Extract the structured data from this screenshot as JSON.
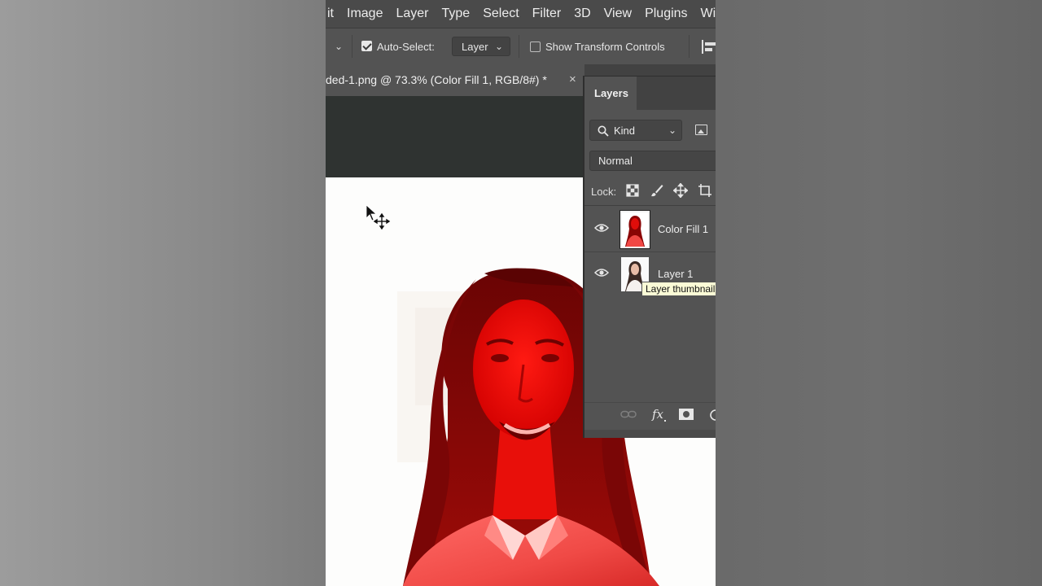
{
  "menubar": {
    "items": [
      "it",
      "Image",
      "Layer",
      "Type",
      "Select",
      "Filter",
      "3D",
      "View",
      "Plugins",
      "Wind"
    ]
  },
  "options_bar": {
    "auto_select_label": "Auto-Select:",
    "auto_select_checked": true,
    "auto_select_target": "Layer",
    "show_transform_label": "Show Transform Controls",
    "show_transform_checked": false
  },
  "document_tab": {
    "title": "ded-1.png @ 73.3% (Color Fill 1, RGB/8#) *",
    "close": "×"
  },
  "layers_panel": {
    "tab_label": "Layers",
    "filter_kind": "Kind",
    "blend_mode": "Normal",
    "lock_label": "Lock:",
    "layers": [
      {
        "name": "Color Fill 1",
        "visible": true,
        "selected": true
      },
      {
        "name": "Layer 1",
        "visible": true,
        "selected": false
      }
    ],
    "tooltip": "Layer thumbnail"
  },
  "colors": {
    "menu_bg": "#4a4a4a",
    "panel_bg": "#535353",
    "pasteboard": "#2f3331",
    "fill_red": "#d40000",
    "tooltip_bg": "#fbfbd6"
  },
  "icons": [
    "search-icon",
    "image-filter-icon",
    "lock-pixels-icon",
    "brush-icon",
    "move-icon",
    "crop-icon",
    "eye-icon",
    "link-icon",
    "fx-icon",
    "mask-icon",
    "adjustment-icon",
    "move-cursor-icon",
    "align-left-icon"
  ]
}
